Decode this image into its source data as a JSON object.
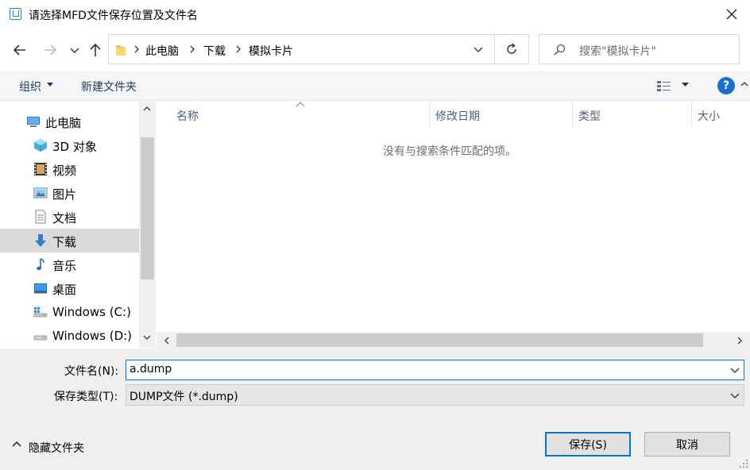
{
  "window": {
    "title": "请选择MFD文件保存位置及文件名",
    "close_glyph": "✕"
  },
  "address_bar": {
    "breadcrumbs": [
      "此电脑",
      "下载",
      "模拟卡片"
    ]
  },
  "search": {
    "placeholder": "搜索\"模拟卡片\""
  },
  "toolbar": {
    "organize_label": "组织",
    "new_folder_label": "新建文件夹",
    "help_glyph": "?"
  },
  "nav_pane": {
    "items": [
      {
        "label": "此电脑",
        "icon": "computer-icon"
      },
      {
        "label": "3D 对象",
        "icon": "3d-objects-icon"
      },
      {
        "label": "视频",
        "icon": "video-icon"
      },
      {
        "label": "图片",
        "icon": "pictures-icon"
      },
      {
        "label": "文档",
        "icon": "documents-icon"
      },
      {
        "label": "下载",
        "icon": "downloads-icon",
        "selected": true
      },
      {
        "label": "音乐",
        "icon": "music-icon"
      },
      {
        "label": "桌面",
        "icon": "desktop-icon"
      },
      {
        "label": "Windows (C:)",
        "icon": "drive-icon"
      },
      {
        "label": "Windows (D:)",
        "icon": "drive-icon"
      }
    ]
  },
  "file_list": {
    "columns": [
      "名称",
      "修改日期",
      "类型",
      "大小"
    ],
    "empty_message": "没有与搜索条件匹配的项。"
  },
  "form": {
    "filename_label": "文件名(N):",
    "filename_value": "a.dump",
    "filetype_label": "保存类型(T):",
    "filetype_value": "DUMP文件 (*.dump)"
  },
  "footer": {
    "hide_folders_label": "隐藏文件夹",
    "save_label": "保存(S)",
    "cancel_label": "取消"
  },
  "colors": {
    "accent": "#0078d7",
    "selection": "#d9d9d9",
    "help": "#1a6fcd"
  }
}
